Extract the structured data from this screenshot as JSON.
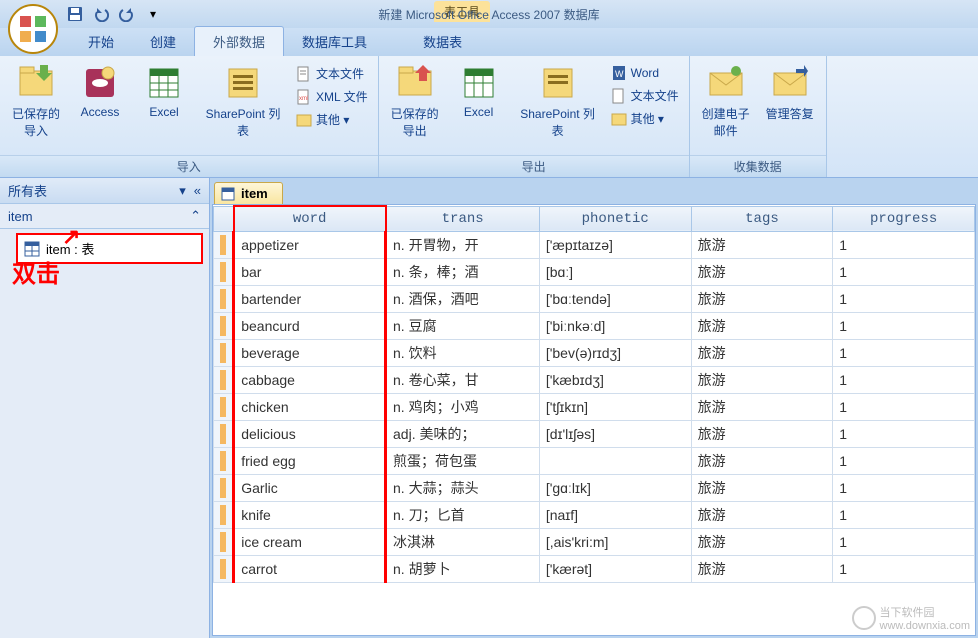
{
  "app_title": "新建 Microsoft Office Access 2007 数据库",
  "contextual_tab": "表工具",
  "tabs": {
    "start": "开始",
    "create": "创建",
    "external": "外部数据",
    "dbtools": "数据库工具",
    "datasheet": "数据表"
  },
  "ribbon": {
    "import": {
      "saved": "已保存的导入",
      "access": "Access",
      "excel": "Excel",
      "sharepoint": "SharePoint 列表",
      "textfile": "文本文件",
      "xmlfile": "XML 文件",
      "other": "其他 ▾",
      "label": "导入"
    },
    "export": {
      "saved": "已保存的导出",
      "excel": "Excel",
      "sharepoint": "SharePoint 列表",
      "word": "Word",
      "textfile": "文本文件",
      "other": "其他 ▾",
      "label": "导出"
    },
    "collect": {
      "create_mail": "创建电子邮件",
      "manage_reply": "管理答复",
      "label": "收集数据"
    }
  },
  "nav": {
    "header": "所有表",
    "group": "item",
    "item": "item : 表"
  },
  "annotation": "双击",
  "sheet_tab": "item",
  "columns": [
    "word",
    "trans",
    "phonetic",
    "tags",
    "progress"
  ],
  "rows": [
    {
      "word": "appetizer",
      "trans": "n. 开胃物，开",
      "phonetic": "['æpɪtaɪzə]",
      "tags": "旅游",
      "progress": "1"
    },
    {
      "word": "bar",
      "trans": "n. 条，棒；酒",
      "phonetic": "[bɑː]",
      "tags": "旅游",
      "progress": "1"
    },
    {
      "word": "bartender",
      "trans": "n. 酒保，酒吧",
      "phonetic": "['bɑːtendə]",
      "tags": "旅游",
      "progress": "1"
    },
    {
      "word": "beancurd",
      "trans": "n. 豆腐",
      "phonetic": "['biːnkəːd]",
      "tags": "旅游",
      "progress": "1"
    },
    {
      "word": "beverage",
      "trans": "n. 饮料",
      "phonetic": "['bev(ə)rɪdʒ]",
      "tags": "旅游",
      "progress": "1"
    },
    {
      "word": "cabbage",
      "trans": "n. 卷心菜，甘",
      "phonetic": "['kæbɪdʒ]",
      "tags": "旅游",
      "progress": "1"
    },
    {
      "word": "chicken",
      "trans": "n. 鸡肉；小鸡",
      "phonetic": "['tʃɪkɪn]",
      "tags": "旅游",
      "progress": "1"
    },
    {
      "word": "delicious",
      "trans": "adj. 美味的；",
      "phonetic": "[dɪ'lɪʃəs]",
      "tags": "旅游",
      "progress": "1"
    },
    {
      "word": "fried egg",
      "trans": "煎蛋；荷包蛋",
      "phonetic": "",
      "tags": "旅游",
      "progress": "1"
    },
    {
      "word": "Garlic",
      "trans": "n. 大蒜；蒜头",
      "phonetic": "['gɑːlɪk]",
      "tags": "旅游",
      "progress": "1"
    },
    {
      "word": "knife",
      "trans": "n. 刀；匕首",
      "phonetic": "[naɪf]",
      "tags": "旅游",
      "progress": "1"
    },
    {
      "word": "ice cream",
      "trans": "冰淇淋",
      "phonetic": "[,ais'kri:m]",
      "tags": "旅游",
      "progress": "1"
    },
    {
      "word": "carrot",
      "trans": "n. 胡萝卜",
      "phonetic": "['kærət]",
      "tags": "旅游",
      "progress": "1"
    }
  ],
  "watermark": {
    "text": "当下软件园",
    "url": "www.downxia.com"
  }
}
